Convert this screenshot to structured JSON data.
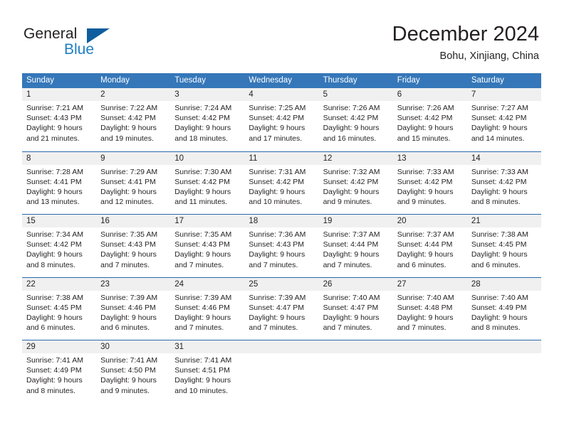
{
  "brand": {
    "word_one": "General",
    "word_two": "Blue",
    "logo_icon": "triangle-logo-icon",
    "accent_color": "#1f7fc4",
    "triangle_color": "#0f5d9e"
  },
  "header": {
    "title": "December 2024",
    "location": "Bohu, Xinjiang, China"
  },
  "calendar": {
    "header_bg": "#3577b9",
    "row_separator_color": "#2c6aad",
    "date_band_color": "#f0f0f0",
    "weekdays": [
      "Sunday",
      "Monday",
      "Tuesday",
      "Wednesday",
      "Thursday",
      "Friday",
      "Saturday"
    ],
    "weeks": [
      [
        {
          "day": "1",
          "sunrise": "Sunrise: 7:21 AM",
          "sunset": "Sunset: 4:43 PM",
          "daylight_line1": "Daylight: 9 hours",
          "daylight_line2": "and 21 minutes."
        },
        {
          "day": "2",
          "sunrise": "Sunrise: 7:22 AM",
          "sunset": "Sunset: 4:42 PM",
          "daylight_line1": "Daylight: 9 hours",
          "daylight_line2": "and 19 minutes."
        },
        {
          "day": "3",
          "sunrise": "Sunrise: 7:24 AM",
          "sunset": "Sunset: 4:42 PM",
          "daylight_line1": "Daylight: 9 hours",
          "daylight_line2": "and 18 minutes."
        },
        {
          "day": "4",
          "sunrise": "Sunrise: 7:25 AM",
          "sunset": "Sunset: 4:42 PM",
          "daylight_line1": "Daylight: 9 hours",
          "daylight_line2": "and 17 minutes."
        },
        {
          "day": "5",
          "sunrise": "Sunrise: 7:26 AM",
          "sunset": "Sunset: 4:42 PM",
          "daylight_line1": "Daylight: 9 hours",
          "daylight_line2": "and 16 minutes."
        },
        {
          "day": "6",
          "sunrise": "Sunrise: 7:26 AM",
          "sunset": "Sunset: 4:42 PM",
          "daylight_line1": "Daylight: 9 hours",
          "daylight_line2": "and 15 minutes."
        },
        {
          "day": "7",
          "sunrise": "Sunrise: 7:27 AM",
          "sunset": "Sunset: 4:42 PM",
          "daylight_line1": "Daylight: 9 hours",
          "daylight_line2": "and 14 minutes."
        }
      ],
      [
        {
          "day": "8",
          "sunrise": "Sunrise: 7:28 AM",
          "sunset": "Sunset: 4:41 PM",
          "daylight_line1": "Daylight: 9 hours",
          "daylight_line2": "and 13 minutes."
        },
        {
          "day": "9",
          "sunrise": "Sunrise: 7:29 AM",
          "sunset": "Sunset: 4:41 PM",
          "daylight_line1": "Daylight: 9 hours",
          "daylight_line2": "and 12 minutes."
        },
        {
          "day": "10",
          "sunrise": "Sunrise: 7:30 AM",
          "sunset": "Sunset: 4:42 PM",
          "daylight_line1": "Daylight: 9 hours",
          "daylight_line2": "and 11 minutes."
        },
        {
          "day": "11",
          "sunrise": "Sunrise: 7:31 AM",
          "sunset": "Sunset: 4:42 PM",
          "daylight_line1": "Daylight: 9 hours",
          "daylight_line2": "and 10 minutes."
        },
        {
          "day": "12",
          "sunrise": "Sunrise: 7:32 AM",
          "sunset": "Sunset: 4:42 PM",
          "daylight_line1": "Daylight: 9 hours",
          "daylight_line2": "and 9 minutes."
        },
        {
          "day": "13",
          "sunrise": "Sunrise: 7:33 AM",
          "sunset": "Sunset: 4:42 PM",
          "daylight_line1": "Daylight: 9 hours",
          "daylight_line2": "and 9 minutes."
        },
        {
          "day": "14",
          "sunrise": "Sunrise: 7:33 AM",
          "sunset": "Sunset: 4:42 PM",
          "daylight_line1": "Daylight: 9 hours",
          "daylight_line2": "and 8 minutes."
        }
      ],
      [
        {
          "day": "15",
          "sunrise": "Sunrise: 7:34 AM",
          "sunset": "Sunset: 4:42 PM",
          "daylight_line1": "Daylight: 9 hours",
          "daylight_line2": "and 8 minutes."
        },
        {
          "day": "16",
          "sunrise": "Sunrise: 7:35 AM",
          "sunset": "Sunset: 4:43 PM",
          "daylight_line1": "Daylight: 9 hours",
          "daylight_line2": "and 7 minutes."
        },
        {
          "day": "17",
          "sunrise": "Sunrise: 7:35 AM",
          "sunset": "Sunset: 4:43 PM",
          "daylight_line1": "Daylight: 9 hours",
          "daylight_line2": "and 7 minutes."
        },
        {
          "day": "18",
          "sunrise": "Sunrise: 7:36 AM",
          "sunset": "Sunset: 4:43 PM",
          "daylight_line1": "Daylight: 9 hours",
          "daylight_line2": "and 7 minutes."
        },
        {
          "day": "19",
          "sunrise": "Sunrise: 7:37 AM",
          "sunset": "Sunset: 4:44 PM",
          "daylight_line1": "Daylight: 9 hours",
          "daylight_line2": "and 7 minutes."
        },
        {
          "day": "20",
          "sunrise": "Sunrise: 7:37 AM",
          "sunset": "Sunset: 4:44 PM",
          "daylight_line1": "Daylight: 9 hours",
          "daylight_line2": "and 6 minutes."
        },
        {
          "day": "21",
          "sunrise": "Sunrise: 7:38 AM",
          "sunset": "Sunset: 4:45 PM",
          "daylight_line1": "Daylight: 9 hours",
          "daylight_line2": "and 6 minutes."
        }
      ],
      [
        {
          "day": "22",
          "sunrise": "Sunrise: 7:38 AM",
          "sunset": "Sunset: 4:45 PM",
          "daylight_line1": "Daylight: 9 hours",
          "daylight_line2": "and 6 minutes."
        },
        {
          "day": "23",
          "sunrise": "Sunrise: 7:39 AM",
          "sunset": "Sunset: 4:46 PM",
          "daylight_line1": "Daylight: 9 hours",
          "daylight_line2": "and 6 minutes."
        },
        {
          "day": "24",
          "sunrise": "Sunrise: 7:39 AM",
          "sunset": "Sunset: 4:46 PM",
          "daylight_line1": "Daylight: 9 hours",
          "daylight_line2": "and 7 minutes."
        },
        {
          "day": "25",
          "sunrise": "Sunrise: 7:39 AM",
          "sunset": "Sunset: 4:47 PM",
          "daylight_line1": "Daylight: 9 hours",
          "daylight_line2": "and 7 minutes."
        },
        {
          "day": "26",
          "sunrise": "Sunrise: 7:40 AM",
          "sunset": "Sunset: 4:47 PM",
          "daylight_line1": "Daylight: 9 hours",
          "daylight_line2": "and 7 minutes."
        },
        {
          "day": "27",
          "sunrise": "Sunrise: 7:40 AM",
          "sunset": "Sunset: 4:48 PM",
          "daylight_line1": "Daylight: 9 hours",
          "daylight_line2": "and 7 minutes."
        },
        {
          "day": "28",
          "sunrise": "Sunrise: 7:40 AM",
          "sunset": "Sunset: 4:49 PM",
          "daylight_line1": "Daylight: 9 hours",
          "daylight_line2": "and 8 minutes."
        }
      ],
      [
        {
          "day": "29",
          "sunrise": "Sunrise: 7:41 AM",
          "sunset": "Sunset: 4:49 PM",
          "daylight_line1": "Daylight: 9 hours",
          "daylight_line2": "and 8 minutes."
        },
        {
          "day": "30",
          "sunrise": "Sunrise: 7:41 AM",
          "sunset": "Sunset: 4:50 PM",
          "daylight_line1": "Daylight: 9 hours",
          "daylight_line2": "and 9 minutes."
        },
        {
          "day": "31",
          "sunrise": "Sunrise: 7:41 AM",
          "sunset": "Sunset: 4:51 PM",
          "daylight_line1": "Daylight: 9 hours",
          "daylight_line2": "and 10 minutes."
        },
        {
          "day": "",
          "sunrise": "",
          "sunset": "",
          "daylight_line1": "",
          "daylight_line2": ""
        },
        {
          "day": "",
          "sunrise": "",
          "sunset": "",
          "daylight_line1": "",
          "daylight_line2": ""
        },
        {
          "day": "",
          "sunrise": "",
          "sunset": "",
          "daylight_line1": "",
          "daylight_line2": ""
        },
        {
          "day": "",
          "sunrise": "",
          "sunset": "",
          "daylight_line1": "",
          "daylight_line2": ""
        }
      ]
    ]
  }
}
